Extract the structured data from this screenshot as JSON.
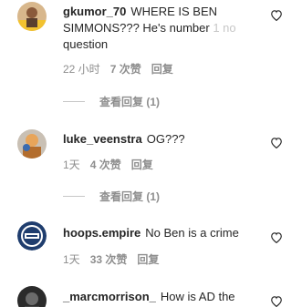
{
  "comments": [
    {
      "username": "gkumor_70",
      "text": "WHERE IS BEN SIMMONS??? He's number ",
      "text_faded": "1 no",
      "text_tail": " question",
      "time": "22 小时",
      "likes": "7 次赞",
      "reply": "回复",
      "view_replies": "查看回复 (1)",
      "avatar": "user-avatar-gkumor"
    },
    {
      "username": "luke_veenstra",
      "text": "OG???",
      "time": "1天",
      "likes": "4 次赞",
      "reply": "回复",
      "view_replies": "查看回复 (1)",
      "avatar": "user-avatar-luke"
    },
    {
      "username": "hoops.empire",
      "text": "No Ben is a crime",
      "time": "1天",
      "likes": "33 次赞",
      "reply": "回复",
      "avatar": "hoops-empire-logo"
    },
    {
      "username": "_marcmorrison_",
      "text": "How is AD the",
      "avatar": "user-avatar-marc"
    }
  ],
  "colors": {
    "text": "#262626",
    "secondary": "#8e8e8e",
    "divider": "#c7c7c7"
  }
}
